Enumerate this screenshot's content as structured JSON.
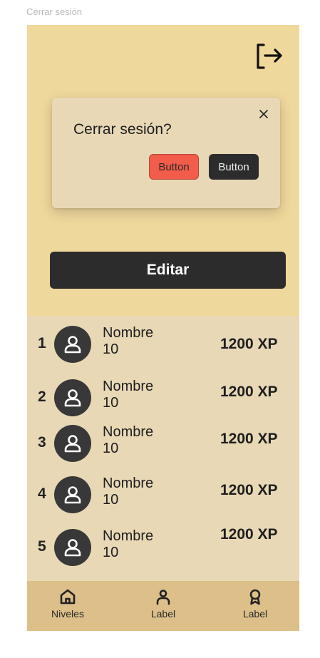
{
  "frame_label": "Cerrar sesión",
  "modal": {
    "title": "Cerrar sesión?",
    "button_red_label": "Button",
    "button_dark_label": "Button"
  },
  "edit_button_label": "Editar",
  "ranking": [
    {
      "rank": "1",
      "name": "Nombre",
      "level": "10",
      "xp": "1200 XP"
    },
    {
      "rank": "2",
      "name": "Nombre",
      "level": "10",
      "xp": "1200 XP"
    },
    {
      "rank": "3",
      "name": "Nombre",
      "level": "10",
      "xp": "1200 XP"
    },
    {
      "rank": "4",
      "name": "Nombre",
      "level": "10",
      "xp": "1200 XP"
    },
    {
      "rank": "5",
      "name": "Nombre",
      "level": "10",
      "xp": "1200 XP"
    }
  ],
  "nav": [
    {
      "label": "Niveles",
      "icon": "home-icon"
    },
    {
      "label": "Label",
      "icon": "user-icon"
    },
    {
      "label": "Label",
      "icon": "award-icon"
    }
  ],
  "colors": {
    "header_bg": "#efd89c",
    "content_bg": "#e8d8b6",
    "nav_bg": "#dcbf89",
    "dark": "#2c2c2c",
    "danger": "#f15d4a"
  }
}
